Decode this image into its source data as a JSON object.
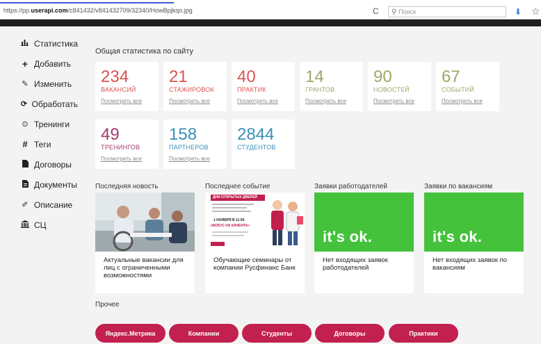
{
  "browser": {
    "url_prefix": "https://pp.",
    "url_host": "userapi.com",
    "url_path": "/c841432/v841432709/32340/HowBpjkqo.jpg",
    "search_placeholder": "Поиск",
    "reload_icon": "reload-icon",
    "download_icon": "download-icon",
    "bookmark_icon": "star-icon"
  },
  "sidebar": {
    "items": [
      {
        "label": "Статистика",
        "icon": "bar-chart-icon"
      },
      {
        "label": "Добавить",
        "icon": "plus-icon"
      },
      {
        "label": "Изменить",
        "icon": "edit-icon"
      },
      {
        "label": "Обработать",
        "icon": "refresh-icon"
      },
      {
        "label": "Тренинги",
        "icon": "clock-icon"
      },
      {
        "label": "Теги",
        "icon": "hash-icon"
      },
      {
        "label": "Договоры",
        "icon": "file-icon"
      },
      {
        "label": "Документы",
        "icon": "document-icon"
      },
      {
        "label": "Описание",
        "icon": "pencil-icon"
      },
      {
        "label": "СЦ",
        "icon": "bank-icon"
      }
    ]
  },
  "main": {
    "title": "Общая статистика по сайту",
    "more_label": "Посмотреть все",
    "stats": [
      {
        "value": "234",
        "label": "ВАКАНСИЙ",
        "color": "#d9534f"
      },
      {
        "value": "21",
        "label": "СТАЖИРОВОК",
        "color": "#d9534f"
      },
      {
        "value": "40",
        "label": "ПРАКТИК",
        "color": "#d9534f"
      },
      {
        "value": "14",
        "label": "ГРАНТОВ",
        "color": "#9aa86a"
      },
      {
        "value": "90",
        "label": "НОВОСТЕЙ",
        "color": "#9aa86a"
      },
      {
        "value": "67",
        "label": "СОБЫТИЙ",
        "color": "#9aa86a"
      },
      {
        "value": "49",
        "label": "ТРЕНИНГОВ",
        "color": "#a33a6a"
      },
      {
        "value": "158",
        "label": "ПАРТНЕРОВ",
        "color": "#3a8fb7"
      },
      {
        "value": "2844",
        "label": "СТУДЕНТОВ",
        "color": "#3a8fb7"
      }
    ],
    "sections": [
      {
        "title": "Последняя новость",
        "caption": "Актуальные вакансии для лиц с ограниченными возможностями"
      },
      {
        "title": "Последнее событие",
        "caption": "Обучающие семинары от компании Русфинанс Банк"
      },
      {
        "title": "Заявки работодателей",
        "caption": "Нет входящих заявок работодателей",
        "ok": "it's ok."
      },
      {
        "title": "Заявки по вакансиям",
        "caption": "Нет входящих заявок по вакансиям",
        "ok": "it's ok."
      }
    ],
    "event_poster": {
      "line1": "ДНИ ОТКРЫТЫХ ДВЕРЕЙ",
      "line2": "1 НОЯБРЯ В 11:00",
      "line3": "«ФОКУС НА КЛИЕНТА»"
    },
    "other_title": "Прочее",
    "buttons": [
      "Яндекс.Метрика",
      "Компании",
      "Студенты",
      "Договоры",
      "Практики"
    ]
  },
  "colors": {
    "accent": "#c2204f",
    "ok_green": "#45c23c"
  }
}
